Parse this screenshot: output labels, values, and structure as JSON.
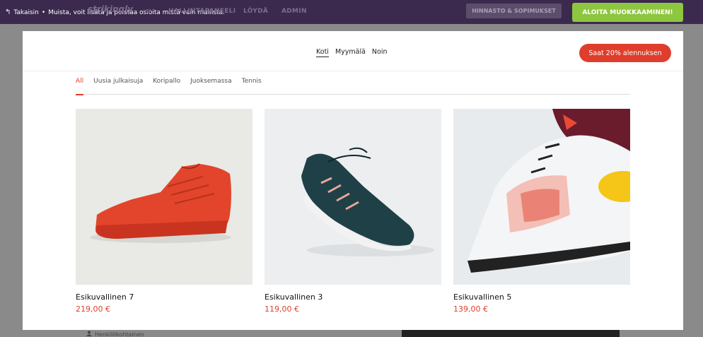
{
  "topbar": {
    "back_label": "Takaisin",
    "tip": "Muista, voit lisätä ja poistaa osioita mistä vain mallista.",
    "logo": "strikingly",
    "vip": "VIP",
    "nav": [
      "HALLINTAPANEELI",
      "LÖYDÄ",
      "ADMIN"
    ],
    "pricing_label": "HINNASTO & SOPIMUKSET",
    "start_label": "ALOITA MUOKKAAMINEN!"
  },
  "background": {
    "card_label": "Henkilökohtainen"
  },
  "site": {
    "nav": [
      "Koti",
      "Myymälä",
      "Noin"
    ],
    "cta_label": "Saat 20% alennuksen"
  },
  "categories": [
    "All",
    "Uusia julkaisuja",
    "Koripallo",
    "Juoksemassa",
    "Tennis"
  ],
  "products": [
    {
      "name": "Esikuvallinen 7",
      "price": "219,00 €"
    },
    {
      "name": "Esikuvallinen 3",
      "price": "119,00 €"
    },
    {
      "name": "Esikuvallinen 5",
      "price": "139,00 €"
    }
  ],
  "colors": {
    "accent": "#e03e2d",
    "topbar": "#3b2a4d",
    "start_button": "#8dc63f"
  }
}
